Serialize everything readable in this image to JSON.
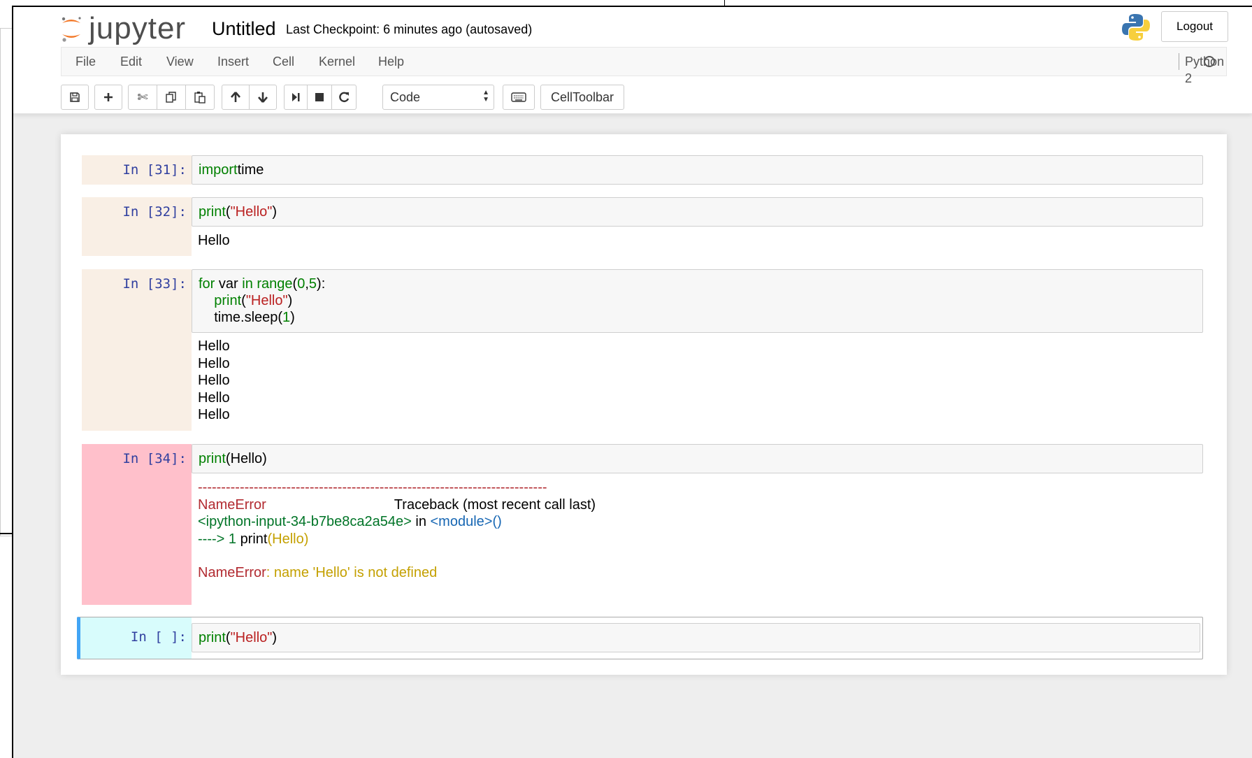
{
  "app": {
    "logo_text": "jupyter",
    "notebook_title": "Untitled",
    "checkpoint": "Last Checkpoint: 6 minutes ago (autosaved)",
    "logout_label": "Logout"
  },
  "menu": {
    "items": [
      "File",
      "Edit",
      "View",
      "Insert",
      "Cell",
      "Kernel",
      "Help"
    ],
    "kernel_name": "Python 2"
  },
  "toolbar": {
    "cell_type": "Code",
    "celltoolbar_label": "CellToolbar",
    "icons": [
      "save-icon",
      "plus-icon",
      "cut-icon",
      "copy-icon",
      "paste-icon",
      "arrow-up-icon",
      "arrow-down-icon",
      "run-icon",
      "stop-icon",
      "restart-icon",
      "keyboard-icon"
    ]
  },
  "cells": [
    {
      "prompt": "In [31]:",
      "code": [
        [
          [
            "kw",
            "import"
          ],
          [
            "",
            "time"
          ]
        ]
      ],
      "output": []
    },
    {
      "prompt": "In [32]:",
      "code": [
        [
          [
            "kw",
            "print"
          ],
          [
            "",
            "("
          ],
          [
            "str",
            "\"Hello\""
          ],
          [
            "",
            ")"
          ]
        ]
      ],
      "output": [
        [
          [
            "",
            "Hello"
          ]
        ]
      ]
    },
    {
      "prompt": "In [33]:",
      "code": [
        [
          [
            "kw",
            "for"
          ],
          [
            "",
            " var "
          ],
          [
            "kw",
            "in"
          ],
          [
            "",
            " "
          ],
          [
            "kw",
            "range"
          ],
          [
            "",
            "("
          ],
          [
            "num",
            "0"
          ],
          [
            "",
            ","
          ],
          [
            "num",
            "5"
          ],
          [
            "",
            "):"
          ]
        ],
        [
          [
            "",
            "    "
          ],
          [
            "kw",
            "print"
          ],
          [
            "",
            "("
          ],
          [
            "str",
            "\"Hello\""
          ],
          [
            "",
            ")"
          ]
        ],
        [
          [
            "",
            "    time.sleep("
          ],
          [
            "num",
            "1"
          ],
          [
            "",
            ")"
          ]
        ]
      ],
      "output": [
        [
          [
            "",
            "Hello"
          ]
        ],
        [
          [
            "",
            "Hello"
          ]
        ],
        [
          [
            "",
            "Hello"
          ]
        ],
        [
          [
            "",
            "Hello"
          ]
        ],
        [
          [
            "",
            "Hello"
          ]
        ]
      ]
    },
    {
      "prompt": "In [34]:",
      "code": [
        [
          [
            "kw",
            "print"
          ],
          [
            "",
            "(Hello)"
          ]
        ]
      ],
      "output": [
        [
          [
            "err-red",
            "---------------------------------------------------------------------------"
          ]
        ],
        [
          [
            "err-red",
            "NameError"
          ],
          [
            "",
            "                                 Traceback (most recent call last)"
          ]
        ],
        [
          [
            "err-green",
            "<ipython-input-34-b7be8ca2a54e>"
          ],
          [
            "",
            " in "
          ],
          [
            "err-blue",
            "<module>()"
          ]
        ],
        [
          [
            "err-green",
            "----> 1 "
          ],
          [
            "",
            "print"
          ],
          [
            "err-yellow",
            "(Hello)"
          ]
        ],
        [
          [
            "",
            ""
          ]
        ],
        [
          [
            "err-red",
            "NameError"
          ],
          [
            "err-yellow",
            ": name 'Hello' is not defined"
          ]
        ]
      ]
    },
    {
      "prompt": "In [ ]:",
      "code": [
        [
          [
            "kw",
            "print"
          ],
          [
            "",
            "("
          ],
          [
            "str",
            "\"Hello\""
          ],
          [
            "",
            ")"
          ]
        ]
      ],
      "output": []
    }
  ],
  "colors": {
    "executed_prompt_bg": "#f9efe5",
    "error_prompt_bg": "#ffc0cb",
    "selected_prompt_bg": "#d8fcfc",
    "selected_border": "#42a5f5",
    "prompt_text": "#303f9f",
    "keyword": "#008000",
    "string": "#ba2121"
  }
}
